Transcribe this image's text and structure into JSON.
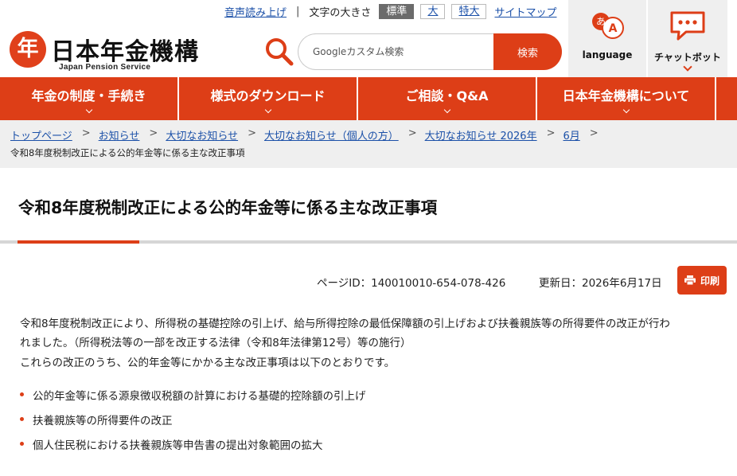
{
  "header": {
    "logo": {
      "name": "日本年金機構",
      "sub": "Japan Pension Service",
      "mark": "年"
    },
    "util": {
      "read_aloud": "音声読み上げ",
      "separator": "|",
      "text_size_label": "文字の大きさ",
      "sizes": [
        "標準",
        "大",
        "特大"
      ],
      "active_size": "標準",
      "sitemap": "サイトマップ"
    },
    "search": {
      "placeholder": "Googleカスタム検索",
      "button": "検索"
    },
    "language": {
      "label": "language",
      "glyph_a": "あ",
      "glyph_b": "A"
    },
    "chatbot": {
      "label": "チャットボット"
    }
  },
  "gnav": {
    "items": [
      "年金の制度・手続き",
      "様式のダウンロード",
      "ご相談・Q&A",
      "日本年金機構について"
    ]
  },
  "breadcrumb": {
    "links": [
      "トップページ",
      "お知らせ",
      "大切なお知らせ",
      "大切なお知らせ（個人の方）",
      "大切なお知らせ 2026年",
      "6月"
    ],
    "separator": ">",
    "current": "令和8年度税制改正による公的年金等に係る主な改正事項"
  },
  "page": {
    "title": "令和8年度税制改正による公的年金等に係る主な改正事項",
    "page_id": "ページID：140010010-654-078-426",
    "updated": "更新日：2026年6月17日",
    "print": "印刷",
    "paragraphs": [
      "令和8年度税制改正により、所得税の基礎控除の引上げ、給与所得控除の最低保障額の引上げおよび扶養親族等の所得要件の改正が行わ",
      "れました。（所得税法等の一部を改正する法律（令和8年法律第12号）等の施行）",
      "これらの改正のうち、公的年金等にかかる主な改正事項は以下のとおりです。"
    ],
    "bullets": [
      "公的年金等に係る源泉徴収税額の計算における基礎的控除額の引上げ",
      "扶養親族等の所得要件の改正",
      "個人住民税における扶養親族等申告書の提出対象範囲の拡大"
    ]
  },
  "colors": {
    "accent": "#dd3e17",
    "link": "#1b50a8",
    "panel": "#efefef"
  },
  "icons": [
    "logo-mark-icon",
    "search-icon",
    "language-icon",
    "chatbot-icon",
    "chevron-down-icon",
    "print-icon",
    "bullet-dot-icon"
  ]
}
